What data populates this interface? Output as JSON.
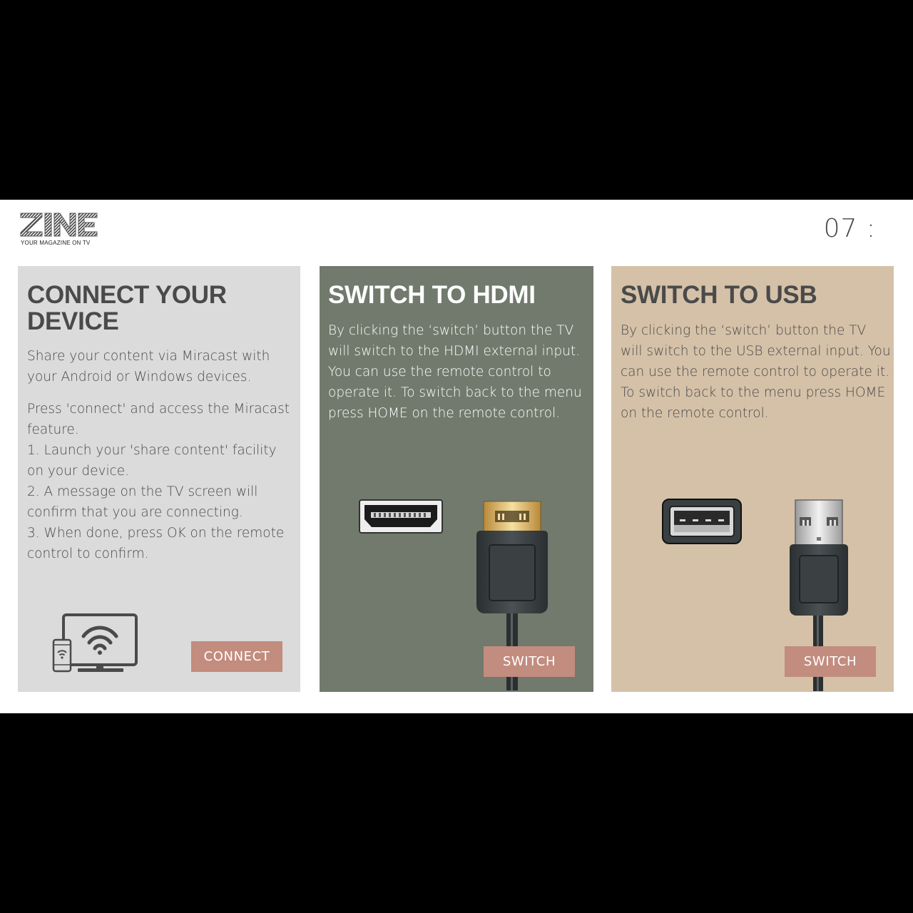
{
  "header": {
    "logo_text": "ZINE",
    "logo_tagline": "YOUR MAGAZINE ON TV",
    "clock": "07 :"
  },
  "panels": [
    {
      "title": "CONNECT YOUR DEVICE",
      "intro": "Share your content via Miracast with your Android or Windows devices.",
      "instructions": [
        "Press 'connect' and access the Miracast feature.",
        "1. Launch your 'share content' facility on your device.",
        "2. A message on the TV screen will confirm that you are connecting.",
        "3. When done, press OK on the remote control to confirm."
      ],
      "button_label": "CONNECT",
      "icon": "miracast-cast-icon"
    },
    {
      "title": "SWITCH TO HDMI",
      "body": "By clicking the ‘switch’ button the TV will switch to the HDMI external input. You can use the remote control to operate it. To switch back to the menu press HOME on the remote control.",
      "button_label": "SWITCH",
      "icon": "hdmi-port-and-cable-icon"
    },
    {
      "title": "SWITCH TO USB",
      "body": "By clicking the ‘switch’ button the TV will switch to the USB external input. You can use the remote control to operate it. To switch back to the menu press HOME on the remote control.",
      "button_label": "SWITCH",
      "icon": "usb-port-and-cable-icon"
    }
  ],
  "colors": {
    "connect_panel_bg": "#dbdbdb",
    "hdmi_panel_bg": "#717a6c",
    "usb_panel_bg": "#d5c1a8",
    "button_bg": "#c28c7e",
    "heading_text": "#4a4a4a"
  }
}
